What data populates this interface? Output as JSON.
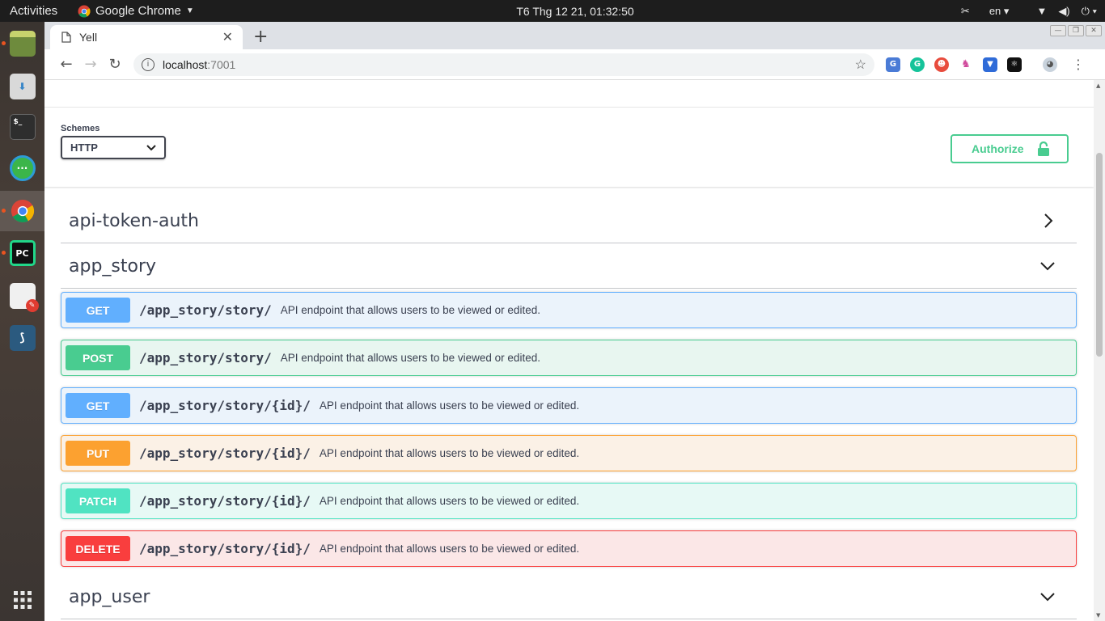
{
  "system": {
    "activities": "Activities",
    "app_name": "Google Chrome",
    "clock": "T6 Thg 12 21, 01:32:50",
    "language": "en"
  },
  "browser": {
    "tab_title": "Yell",
    "url_host": "localhost",
    "url_port": ":7001"
  },
  "swagger": {
    "schemes_label": "Schemes",
    "scheme_selected": "HTTP",
    "authorize_label": "Authorize",
    "tags": [
      {
        "name": "api-token-auth",
        "expanded": false
      },
      {
        "name": "app_story",
        "expanded": true
      },
      {
        "name": "app_user",
        "expanded": true
      }
    ],
    "operations": [
      {
        "method": "GET",
        "path": "/app_story/story/",
        "description": "API endpoint that allows users to be viewed or edited.",
        "color": "#61affe",
        "bg": "#ebf3fb"
      },
      {
        "method": "POST",
        "path": "/app_story/story/",
        "description": "API endpoint that allows users to be viewed or edited.",
        "color": "#49cc90",
        "bg": "#e8f6f0"
      },
      {
        "method": "GET",
        "path": "/app_story/story/{id}/",
        "description": "API endpoint that allows users to be viewed or edited.",
        "color": "#61affe",
        "bg": "#ebf3fb"
      },
      {
        "method": "PUT",
        "path": "/app_story/story/{id}/",
        "description": "API endpoint that allows users to be viewed or edited.",
        "color": "#fca130",
        "bg": "#fbf1e6"
      },
      {
        "method": "PATCH",
        "path": "/app_story/story/{id}/",
        "description": "API endpoint that allows users to be viewed or edited.",
        "color": "#50e3c2",
        "bg": "#e7f9f5"
      },
      {
        "method": "DELETE",
        "path": "/app_story/story/{id}/",
        "description": "API endpoint that allows users to be viewed or edited.",
        "color": "#f93e3e",
        "bg": "#fbe7e7"
      }
    ]
  }
}
